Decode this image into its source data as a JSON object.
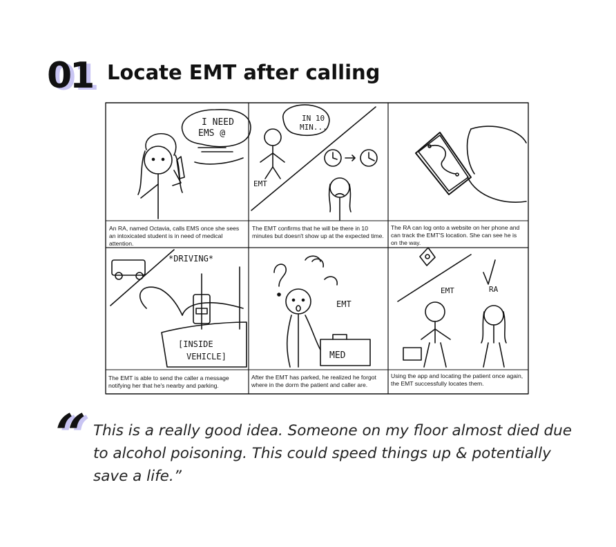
{
  "section": {
    "number": "01",
    "title": "Locate EMT after calling"
  },
  "storyboard": {
    "panels": [
      {
        "caption": "An RA, named Octavia, calls EMS once she sees an intoxicated student is in need of medical attention.",
        "sketch_text": [
          "I NEED",
          "EMS @"
        ]
      },
      {
        "caption": "The EMT confirms that he will be there in 10 minutes but doesn't show up at the expected time.",
        "sketch_text": [
          "IN 10",
          "MIN...",
          "EMT"
        ]
      },
      {
        "caption": "The RA can log onto a website on her phone and can track the EMT'S location. She can see he is on the way.",
        "sketch_text": []
      },
      {
        "caption": "The EMT is able to send the caller a message notifying her that he's nearby and parking.",
        "sketch_text": [
          "*DRIVING*",
          "[INSIDE",
          "VEHICLE]"
        ]
      },
      {
        "caption": "After the EMT has parked, he realized he forgot where in the dorm the patient and caller are.",
        "sketch_text": [
          "EMT",
          "MED"
        ]
      },
      {
        "caption": "Using the app and locating the patient once again, the EMT successfully locates them.",
        "sketch_text": [
          "EMT",
          "RA"
        ]
      }
    ]
  },
  "quote": {
    "mark": "“",
    "text": "This is a really good idea. Someone on my floor almost died due to alcohol poisoning. This could speed things up & potentially save a life.”"
  },
  "colors": {
    "accent": "#c9c5f3",
    "ink": "#111111"
  }
}
